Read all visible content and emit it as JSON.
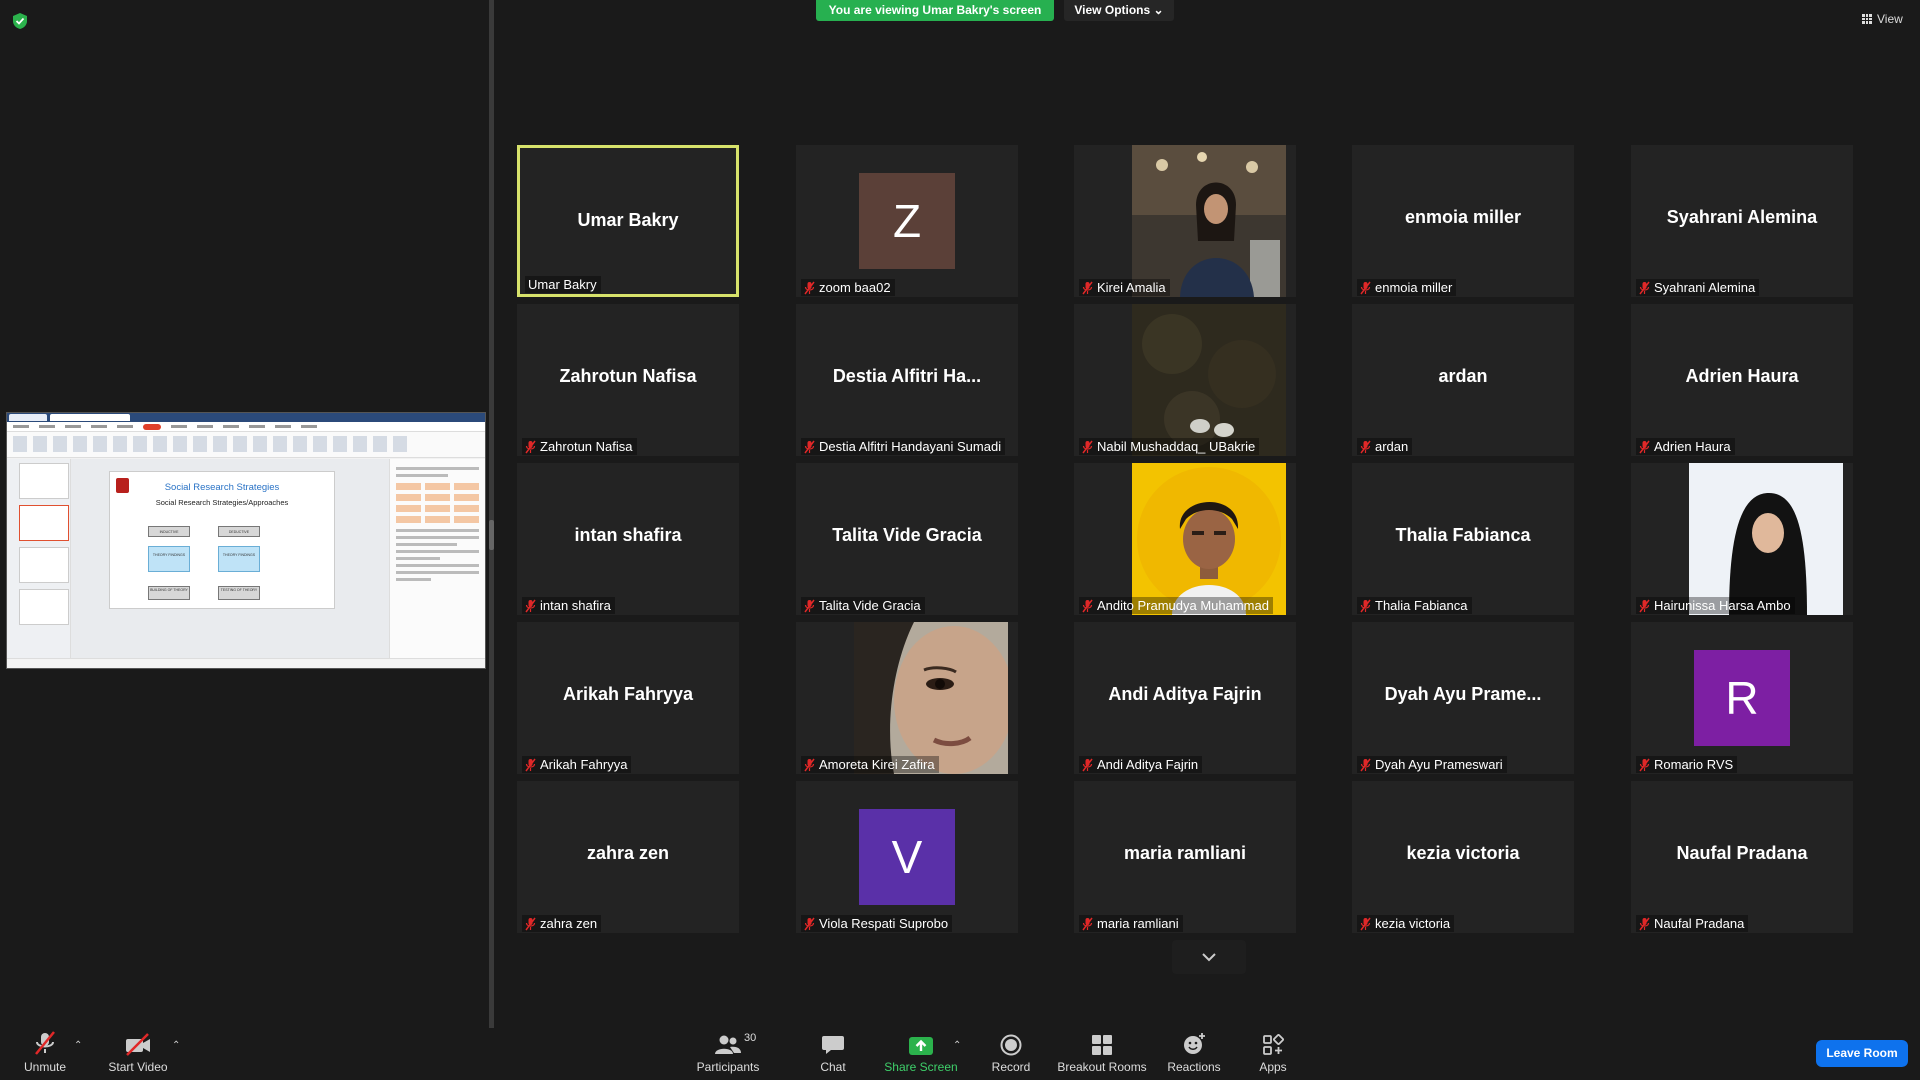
{
  "banner": {
    "viewing_text": "You are viewing Umar Bakry's screen",
    "view_options_label": "View Options",
    "view_label": "View"
  },
  "shared_screen": {
    "slide_title": "Social Research Strategies",
    "slide_subtitle": "Social Research Strategies/Approaches",
    "boxes": {
      "inductive": "INDUCTIVE",
      "deductive": "DEDUCTIVE",
      "theory_findings_1": "THEORY FINDINGS",
      "theory_findings_2": "THEORY FINDINGS",
      "building": "BUILDING OF THEORY",
      "testing": "TESTING OF THEORY"
    }
  },
  "participants": [
    {
      "display": "Umar Bakry",
      "name": "Umar Bakry",
      "type": "name",
      "muted": false,
      "active": true
    },
    {
      "display": "Z",
      "name": "zoom baa02",
      "type": "avatar",
      "color": "#5b4038",
      "muted": true
    },
    {
      "display": "",
      "name": "Kirei Amalia",
      "type": "photo",
      "photo": "kirei",
      "muted": true
    },
    {
      "display": "enmoia miller",
      "name": "enmoia miller",
      "type": "name",
      "muted": true
    },
    {
      "display": "Syahrani Alemina",
      "name": "Syahrani Alemina",
      "type": "name",
      "muted": true
    },
    {
      "display": "Zahrotun Nafisa",
      "name": "Zahrotun Nafisa",
      "type": "name",
      "muted": true
    },
    {
      "display": "Destia Alfitri Ha...",
      "name": "Destia Alfitri Handayani Sumadi",
      "type": "name",
      "muted": true
    },
    {
      "display": "",
      "name": "Nabil Mushaddaq_ UBakrie",
      "type": "photo",
      "photo": "nabil",
      "muted": true
    },
    {
      "display": "ardan",
      "name": "ardan",
      "type": "name",
      "muted": true
    },
    {
      "display": "Adrien Haura",
      "name": "Adrien Haura",
      "type": "name",
      "muted": true
    },
    {
      "display": "intan shafira",
      "name": "intan shafira",
      "type": "name",
      "muted": true
    },
    {
      "display": "Talita Vide Gracia",
      "name": "Talita Vide Gracia",
      "type": "name",
      "muted": true
    },
    {
      "display": "",
      "name": "Andito Pramudya Muhammad",
      "type": "photo",
      "photo": "andito",
      "muted": true
    },
    {
      "display": "Thalia Fabianca",
      "name": "Thalia Fabianca",
      "type": "name",
      "muted": true
    },
    {
      "display": "",
      "name": "Hairunissa Harsa Ambo",
      "type": "photo",
      "photo": "hairunissa",
      "muted": true
    },
    {
      "display": "Arikah Fahryya",
      "name": "Arikah Fahryya",
      "type": "name",
      "muted": true
    },
    {
      "display": "",
      "name": "Amoreta Kirei Zafira",
      "type": "photo",
      "photo": "amoreta",
      "muted": true
    },
    {
      "display": "Andi Aditya Fajrin",
      "name": "Andi Aditya Fajrin",
      "type": "name",
      "muted": true
    },
    {
      "display": "Dyah Ayu Prame...",
      "name": "Dyah Ayu Prameswari",
      "type": "name",
      "muted": true
    },
    {
      "display": "R",
      "name": "Romario RVS",
      "type": "avatar",
      "color": "#7d1fa3",
      "muted": true
    },
    {
      "display": "zahra zen",
      "name": "zahra zen",
      "type": "name",
      "muted": true
    },
    {
      "display": "V",
      "name": "Viola Respati Suprobo",
      "type": "avatar",
      "color": "#5a30a8",
      "muted": true
    },
    {
      "display": "maria ramliani",
      "name": "maria ramliani",
      "type": "name",
      "muted": true
    },
    {
      "display": "kezia victoria",
      "name": "kezia victoria",
      "type": "name",
      "muted": true
    },
    {
      "display": "Naufal Pradana",
      "name": "Naufal Pradana",
      "type": "name",
      "muted": true
    }
  ],
  "toolbar": {
    "unmute": "Unmute",
    "start_video": "Start Video",
    "participants": "Participants",
    "participants_count": "30",
    "chat": "Chat",
    "share_screen": "Share Screen",
    "record": "Record",
    "breakout_rooms": "Breakout Rooms",
    "reactions": "Reactions",
    "apps": "Apps",
    "leave_room": "Leave Room"
  },
  "colors": {
    "active_border": "#d7e26b",
    "banner_green": "#27b050",
    "leave_blue": "#0e72ed",
    "mute_red": "#e02828"
  }
}
